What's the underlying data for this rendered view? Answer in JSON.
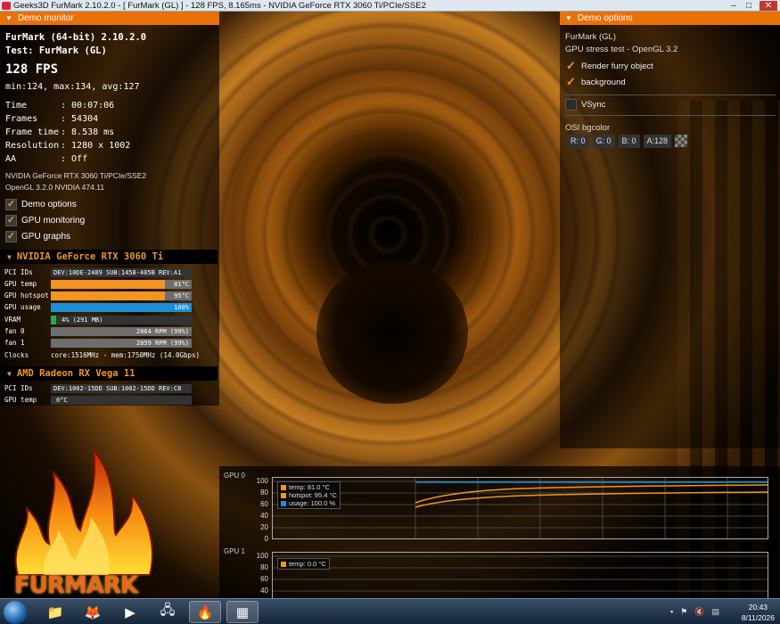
{
  "window": {
    "title": "Geeks3D FurMark 2.10.2.0 - [ FurMark (GL) ] - 128 FPS, 8.165ms - NVIDIA GeForce RTX 3060 Ti/PCIe/SSE2",
    "minimize_icon": "minimize-icon",
    "maximize_icon": "maximize-icon",
    "close_icon": "close-icon"
  },
  "demo_monitor": {
    "header": "Demo monitor",
    "version": "FurMark (64-bit) 2.10.2.0",
    "test": "Test: FurMark (GL)",
    "fps": "128 FPS",
    "fps_stats": "min:124, max:134, avg:127",
    "stats": [
      {
        "key": "Time",
        "value": ": 00:07:06"
      },
      {
        "key": "Frames",
        "value": ": 54304"
      },
      {
        "key": "Frame time",
        "value": ": 8.538 ms"
      },
      {
        "key": "Resolution",
        "value": ": 1280 x 1002"
      },
      {
        "key": "AA",
        "value": ": Off"
      }
    ],
    "gpu_renderer": "NVIDIA GeForce RTX 3060 Ti/PCIe/SSE2",
    "gl_version": "OpenGL 3.2.0 NVIDIA 474.11",
    "checkboxes": [
      {
        "label": "Demo options",
        "checked": true
      },
      {
        "label": "GPU monitoring",
        "checked": true
      },
      {
        "label": "GPU graphs",
        "checked": true
      }
    ]
  },
  "gpu0": {
    "name": "NVIDIA GeForce RTX 3060 Ti",
    "pci_label": "PCI IDs",
    "pci_value": "DEV:10DE-2489 SUB:1458-405B REV:A1",
    "temp_label": "GPU temp",
    "temp_text": "81°C",
    "temp_fraction": 0.81,
    "hotspot_label": "GPU hotspot",
    "hotspot_text": "95°C",
    "hotspot_fraction": 0.81,
    "usage_label": "GPU usage",
    "usage_text": "100%",
    "usage_fraction": 1.0,
    "vram_label": "VRAM",
    "vram_text": "4% (291 MB)",
    "vram_fraction": 0.04,
    "fan0_label": "fan 0",
    "fan0_text": "2064 RPM (99%)",
    "fan1_label": "fan 1",
    "fan1_text": "2059 RPM (99%)",
    "clocks_label": "Clocks",
    "clocks_text": "core:1516MHz - mem:1750MHz (14.0Gbps)"
  },
  "gpu1": {
    "name": "AMD Radeon RX Vega 11",
    "pci_label": "PCI IDs",
    "pci_value": "DEV:1002-15DD SUB:1002-15DD REV:C8",
    "temp_label": "GPU temp",
    "temp_text": "0°C"
  },
  "logo_text": "FURMARK",
  "demo_options": {
    "header": "Demo options",
    "line1": "FurMark (GL)",
    "line2": "GPU stress test - OpenGL 3.2",
    "checkboxes": [
      {
        "label": "Render furry object",
        "checked": true
      },
      {
        "label": "background",
        "checked": true
      }
    ],
    "vsync_label": "VSync",
    "vsync_checked": false,
    "osi_label": "OSI bgcolor",
    "osi_fields": [
      "R:  0",
      "G:  0",
      "B:  0",
      "A:128"
    ]
  },
  "graphs": {
    "gpu0_title": "GPU 0",
    "gpu1_title": "GPU 1",
    "gpu0_ticks": [
      "100",
      "80",
      "60",
      "40",
      "20",
      "0"
    ],
    "gpu1_ticks": [
      "100",
      "80",
      "60",
      "40"
    ],
    "gpu0_legend": [
      {
        "label": "temp: 81.0 °C",
        "color": "#f29522"
      },
      {
        "label": "hotspot: 95.4 °C",
        "color": "#f29522"
      },
      {
        "label": "usage: 100.0 %",
        "color": "#1e8ed6"
      }
    ],
    "gpu1_legend": [
      {
        "label": "temp: 0.0 °C",
        "color": "#f29522"
      }
    ]
  },
  "taskbar": {
    "time": "20:43",
    "date": "8/11/2026",
    "apps": [
      "folder-icon",
      "firefox-icon",
      "media-player-icon",
      "network-icon",
      "furmark-icon",
      "app-window-icon"
    ]
  },
  "colors": {
    "accent": "#e8710a",
    "temp_bar": "#f29522",
    "usage_bar": "#1e8ed6",
    "vram_bar": "#2ea84a"
  }
}
